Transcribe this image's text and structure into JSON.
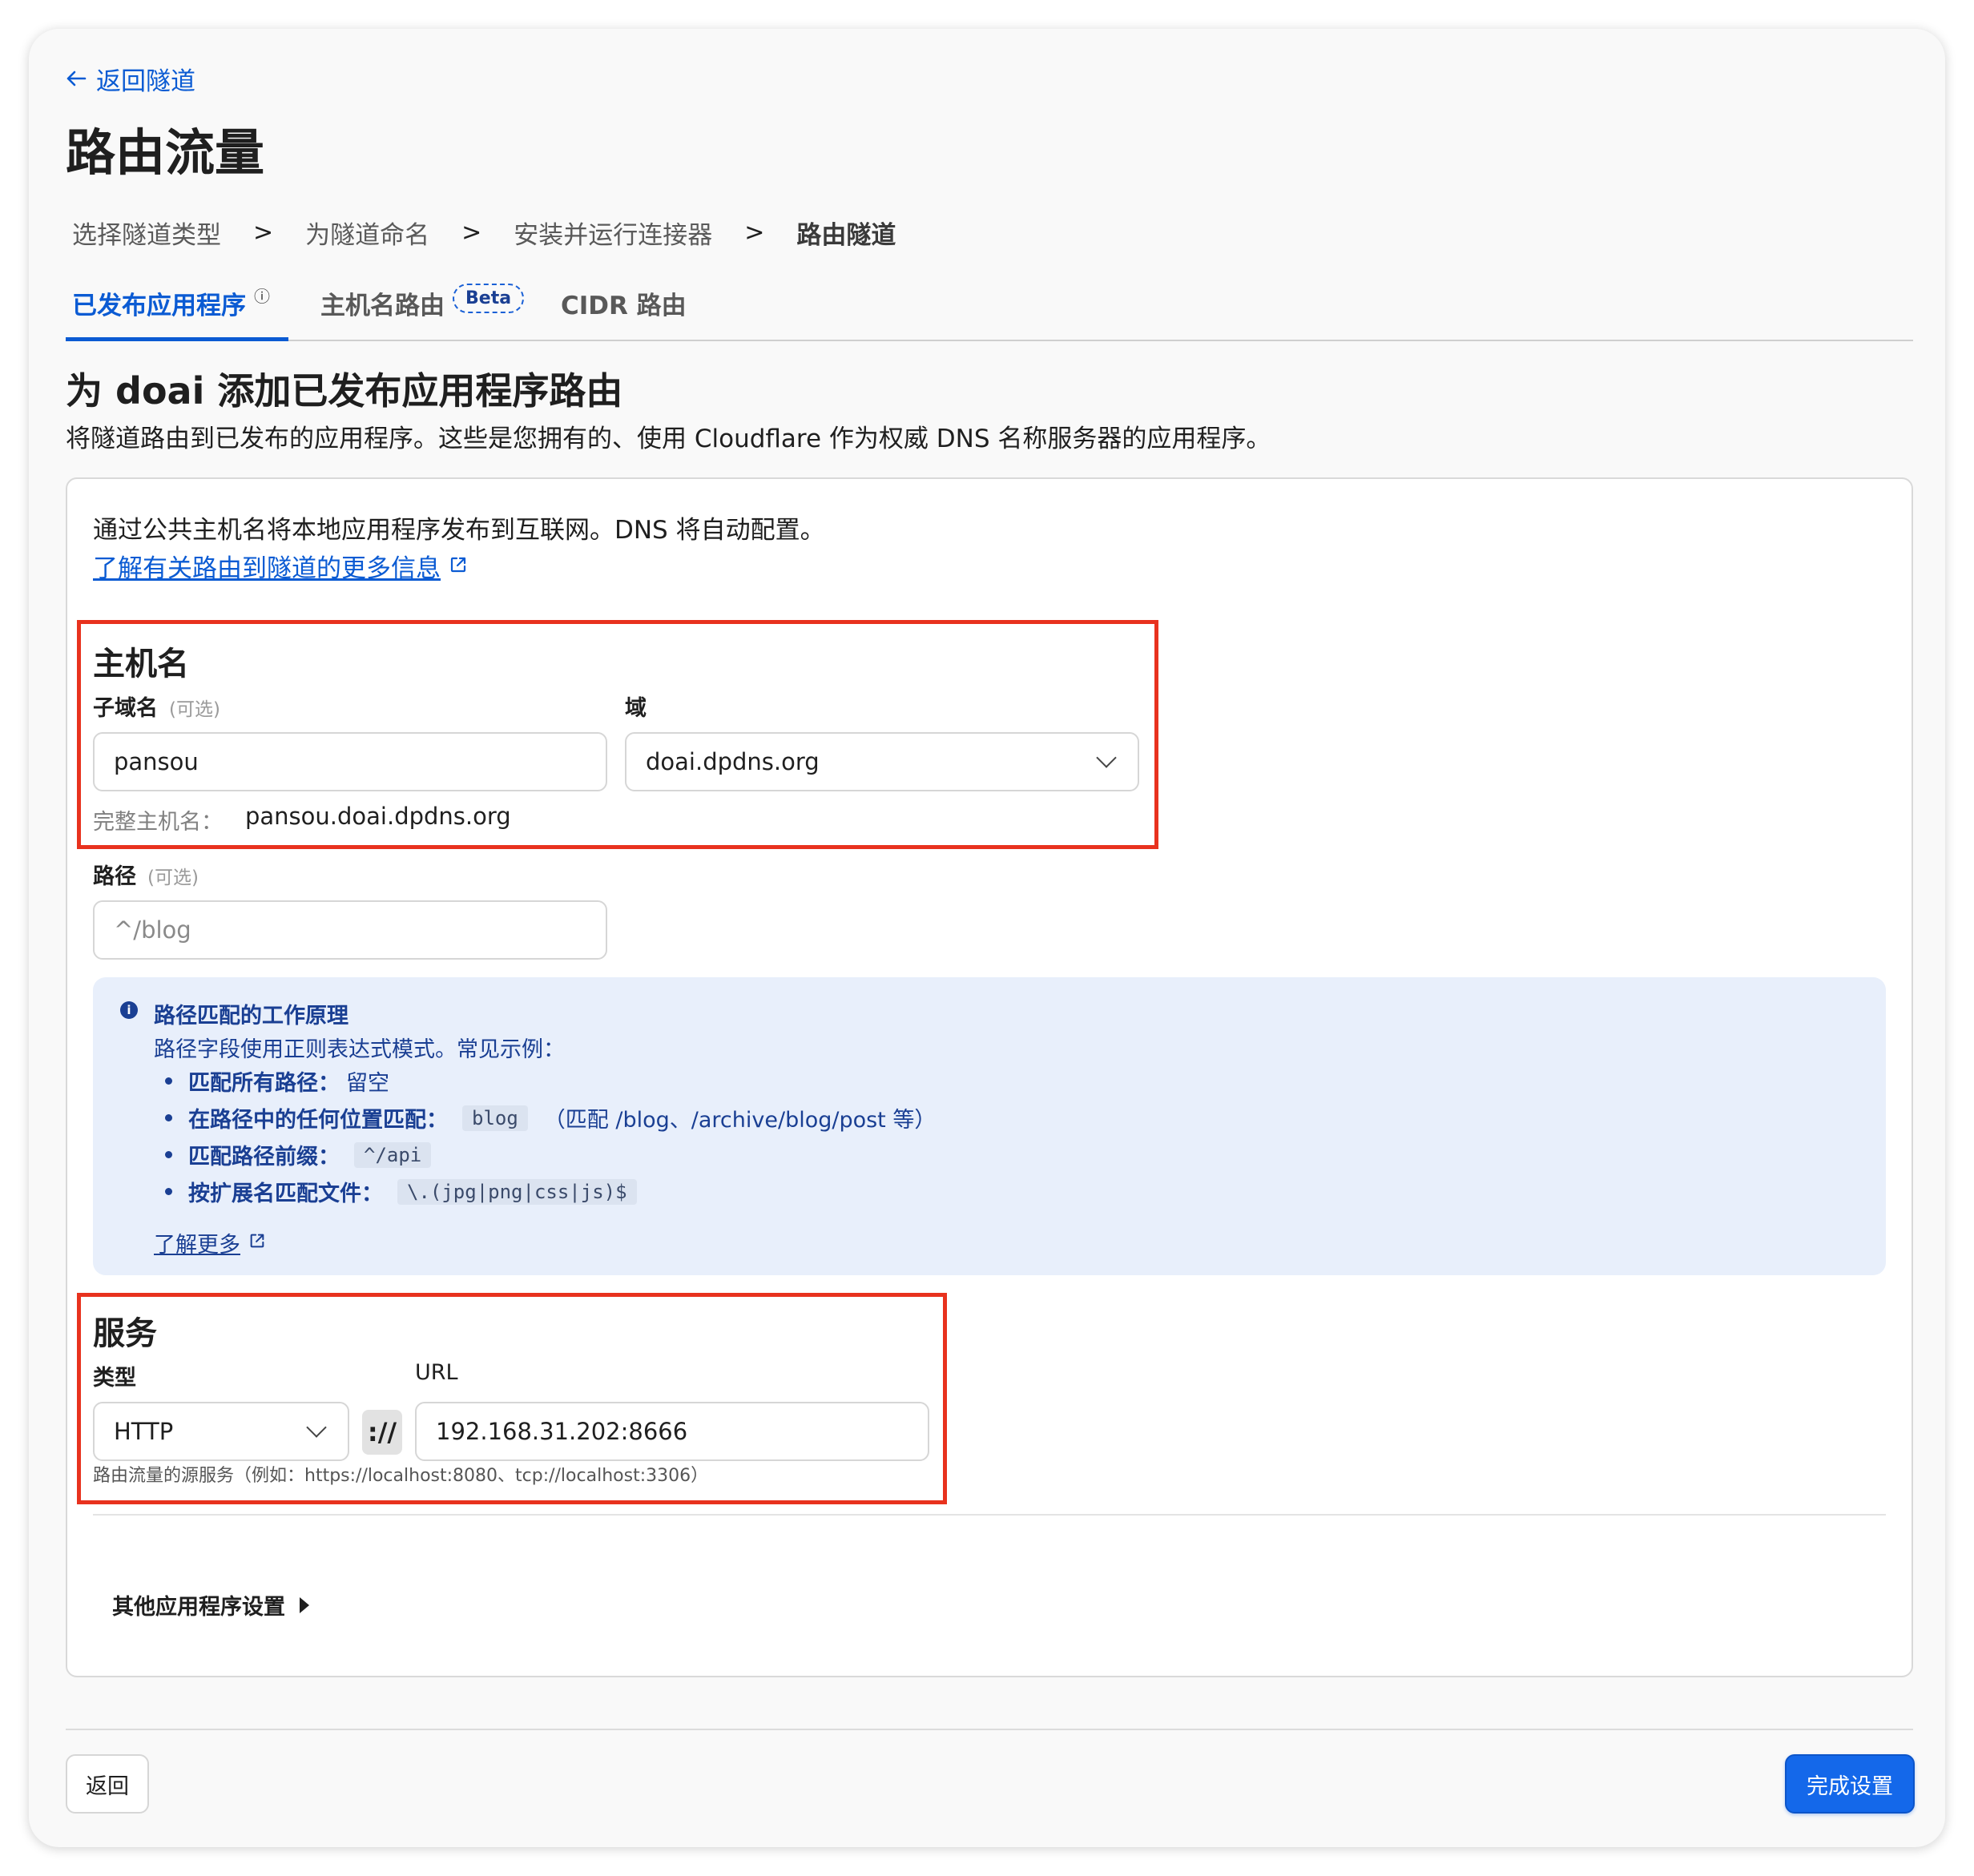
{
  "header": {
    "back_link": "返回隧道",
    "title": "路由流量"
  },
  "steps": [
    "选择隧道类型",
    "为隧道命名",
    "安装并运行连接器",
    "路由隧道"
  ],
  "step_separator": ">",
  "tabs": {
    "published_apps": "已发布应用程序",
    "hostname_routes": "主机名路由",
    "beta": "Beta",
    "cidr_routes": "CIDR 路由"
  },
  "section": {
    "title": "为 doai 添加已发布应用程序路由",
    "description": "将隧道路由到已发布的应用程序。这些是您拥有的、使用 Cloudflare 作为权威 DNS 名称服务器的应用程序。"
  },
  "card": {
    "intro": "通过公共主机名将本地应用程序发布到互联网。DNS 将自动配置。",
    "learn_more_link": "了解有关路由到隧道的更多信息"
  },
  "hostname": {
    "heading": "主机名",
    "subdomain_label": "子域名",
    "optional": "(可选)",
    "subdomain_value": "pansou",
    "domain_label": "域",
    "domain_value": "doai.dpdns.org",
    "full_hostname_label": "完整主机名：",
    "full_hostname_value": "pansou.doai.dpdns.org"
  },
  "path": {
    "label": "路径",
    "optional": "(可选)",
    "placeholder": "^/blog"
  },
  "path_info": {
    "title": "路径匹配的工作原理",
    "description": "路径字段使用正则表达式模式。常见示例：",
    "bullets": [
      {
        "label": "匹配所有路径：",
        "text": "留空"
      },
      {
        "label": "在路径中的任何位置匹配：",
        "code": "blog",
        "text": "（匹配 /blog、/archive/blog/post 等）"
      },
      {
        "label": "匹配路径前缀：",
        "code": "^/api"
      },
      {
        "label": "按扩展名匹配文件：",
        "code": "\\.(jpg|png|css|js)$"
      }
    ],
    "learn_more": "了解更多"
  },
  "service": {
    "heading": "服务",
    "type_label": "类型",
    "type_value": "HTTP",
    "separator": "://",
    "url_label": "URL",
    "url_value": "192.168.31.202:8666",
    "help": "路由流量的源服务（例如：https://localhost:8080、tcp://localhost:3306）"
  },
  "advanced": {
    "label": "其他应用程序设置"
  },
  "footer": {
    "back": "返回",
    "finish": "完成设置"
  },
  "colors": {
    "accent": "#1468ea",
    "link": "#0b5bd3",
    "highlight": "#e8321e",
    "info_bg": "#e8effb"
  }
}
